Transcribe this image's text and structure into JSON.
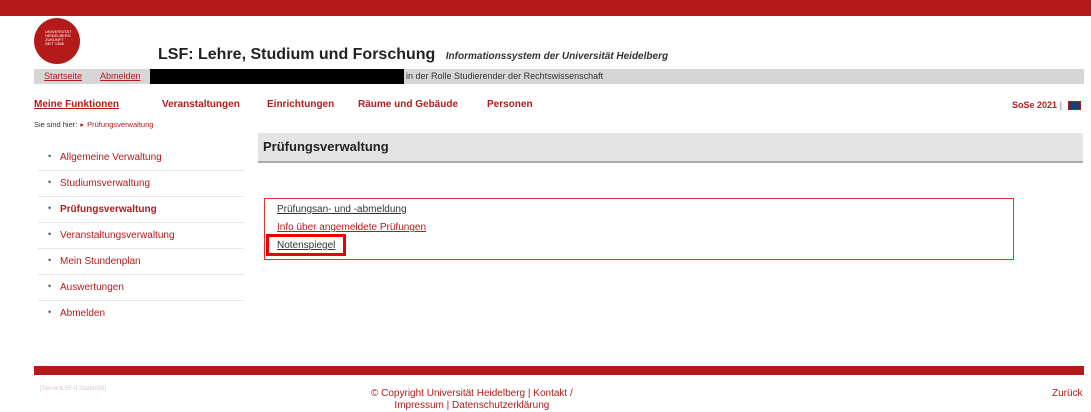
{
  "colors": {
    "brand": "#b31b1b",
    "highlight": "#e00000"
  },
  "logo": {
    "text": "UNIVERSITÄT HEIDELBERG ZUKUNFT SEIT 1386"
  },
  "header": {
    "title": "LSF: Lehre, Studium und Forschung",
    "subtitle": "Informationssystem der Universität Heidelberg"
  },
  "userbar": {
    "start": "Startseite",
    "logout": "Abmelden",
    "role": "in der Rolle Studierender der Rechtswissenschaft"
  },
  "nav": [
    {
      "label": "Meine Funktionen"
    },
    {
      "label": "Veranstaltungen"
    },
    {
      "label": "Einrichtungen"
    },
    {
      "label": "Räume und Gebäude"
    },
    {
      "label": "Personen"
    }
  ],
  "semester": {
    "label": "SoSe 2021",
    "separator": "|",
    "lang_icon": "uk-flag-icon"
  },
  "breadcrumb": {
    "prefix": "Sie sind hier:",
    "current": "Prüfungsverwaltung"
  },
  "sidebar": {
    "items": [
      {
        "label": "Allgemeine Verwaltung"
      },
      {
        "label": "Studiumsverwaltung"
      },
      {
        "label": "Prüfungsverwaltung"
      },
      {
        "label": "Veranstaltungsverwaltung"
      },
      {
        "label": "Mein Stundenplan"
      },
      {
        "label": "Auswertungen"
      },
      {
        "label": "Abmelden"
      }
    ]
  },
  "content": {
    "title": "Prüfungsverwaltung",
    "links": [
      {
        "label": "Prüfungsan- und -abmeldung"
      },
      {
        "label": "Info über angemeldete Prüfungen"
      },
      {
        "label": "Notenspiegel"
      }
    ]
  },
  "footer": {
    "left": "[ServerILSF-II Station09]",
    "copyright": "© Copyright Universität Heidelberg",
    "sep": "|",
    "contact": "Kontakt /",
    "imprint": "Impressum",
    "privacy": "Datenschutzerklärung",
    "back": "Zurück"
  }
}
